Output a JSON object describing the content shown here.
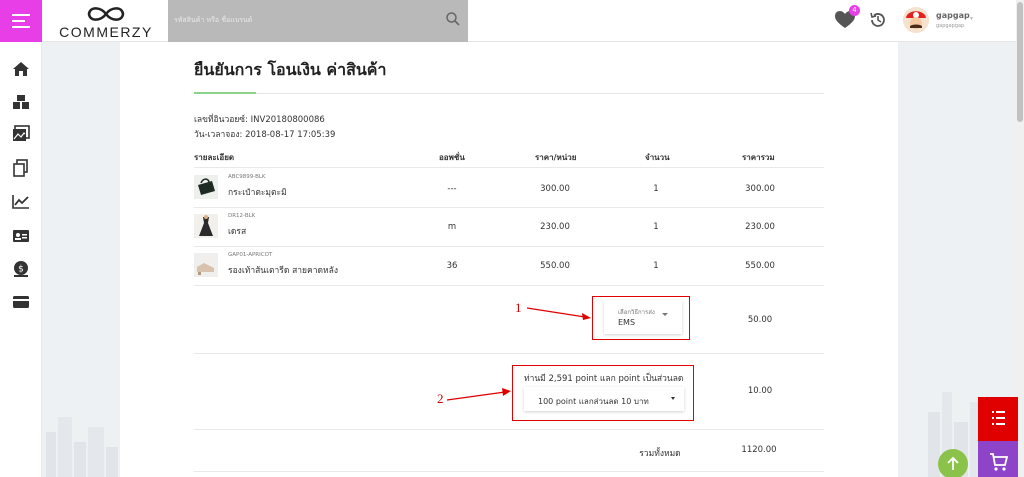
{
  "brand": {
    "name": "COMMERZY"
  },
  "search": {
    "placeholder": "รหัสสินค้า หรือ ชื่อแบรนด์"
  },
  "header": {
    "wishlist_count": "4",
    "user_name": "gapgap",
    "user_sub": "gapgapgap"
  },
  "page": {
    "title": "ยืนยันการ โอนเงิน ค่าสินค้า"
  },
  "invoice": {
    "number_text": "เลขที่อินวอยซ์: INV20180800086",
    "datetime_text": "วัน-เวลาจอง: 2018-08-17 17:05:39"
  },
  "table": {
    "headers": {
      "detail": "รายละเอียด",
      "option": "ออพชั่น",
      "unit_price": "ราคา/หน่วย",
      "qty": "จำนวน",
      "total": "ราคารวม"
    },
    "rows": [
      {
        "sku": "ABC9899-BLK",
        "name": "กระเป๋าตะมุตะมิ",
        "option": "---",
        "unit_price": "300.00",
        "qty": "1",
        "total": "300.00"
      },
      {
        "sku": "DR12-BLK",
        "name": "เดรส",
        "option": "m",
        "unit_price": "230.00",
        "qty": "1",
        "total": "230.00"
      },
      {
        "sku": "GAP01-APRICOT",
        "name": "รองเท้าส้นเตารีด สายคาดหลัง",
        "option": "36",
        "unit_price": "550.00",
        "qty": "1",
        "total": "550.00"
      }
    ]
  },
  "shipping": {
    "label": "เลือกวิธีการส่ง",
    "value": "EMS",
    "cost": "50.00"
  },
  "points": {
    "text": "ท่านมี 2,591 point แลก point เป็นส่วนลด",
    "selected": "100 point แลกส่วนลด 10 บาท",
    "discount": "10.00"
  },
  "summary": {
    "label": "รวมทั้งหมด",
    "value": "1120.00"
  },
  "annotations": {
    "one": "1",
    "two": "2"
  },
  "colors": {
    "accent": "#e83ee8",
    "annotation": "#e00000",
    "fab_red": "#e00000",
    "fab_purple": "#8e44c9",
    "fab_green": "#8bc34a"
  }
}
